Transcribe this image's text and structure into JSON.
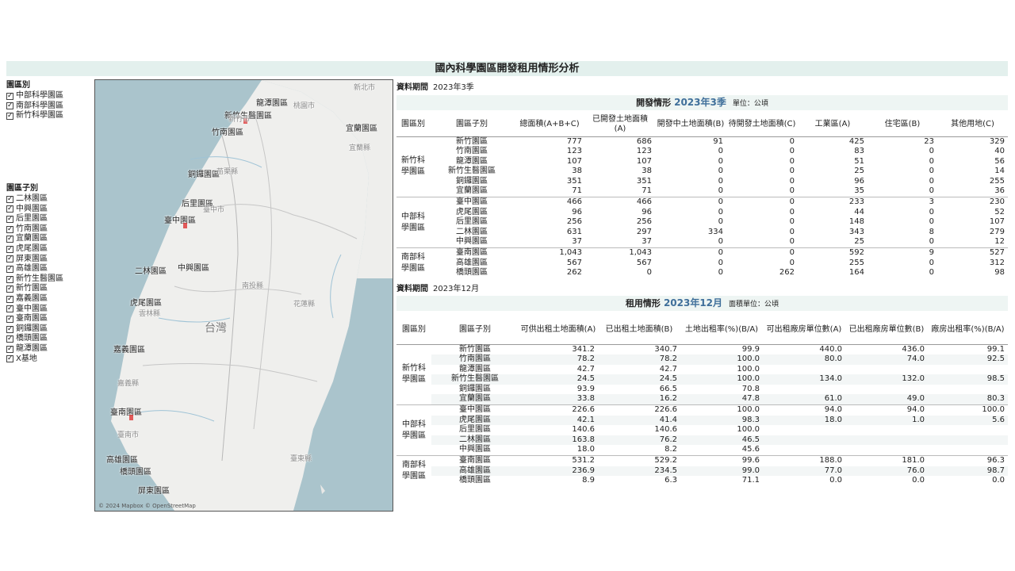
{
  "title": "國內科學園區開發租用情形分析",
  "filters": {
    "park_heading": "園區別",
    "parks": [
      "中部科學園區",
      "南部科學園區",
      "新竹科學園區"
    ],
    "sub_heading": "園區子別",
    "subs": [
      "二林園區",
      "中興園區",
      "后里園區",
      "竹南園區",
      "宜蘭園區",
      "虎尾園區",
      "屏東園區",
      "高雄園區",
      "新竹生醫園區",
      "新竹園區",
      "嘉義園區",
      "臺中園區",
      "臺南園區",
      "銅鑼園區",
      "橋頭園區",
      "龍潭園區",
      "X基地"
    ]
  },
  "map": {
    "attribution": "© 2024 Mapbox © OpenStreetMap",
    "labels": [
      "龍潭園區",
      "新竹生醫園區",
      "竹南園區",
      "宜蘭園區",
      "銅鑼園區",
      "后里園區",
      "臺中園區",
      "二林園區",
      "中興園區",
      "虎尾園區",
      "嘉義園區",
      "臺南園區",
      "高雄園區",
      "橋頭園區",
      "屏東園區"
    ],
    "minor_labels": [
      "新北市",
      "桃園市",
      "新竹市",
      "宜蘭縣",
      "苗栗縣",
      "臺中市",
      "南投縣",
      "花蓮縣",
      "雲林縣",
      "嘉義縣",
      "臺南市",
      "臺東縣"
    ],
    "big_label": "台灣"
  },
  "dev": {
    "period_label": "資料期間",
    "period_value": "2023年3季",
    "section": "開發情形",
    "highlight": "2023年3季",
    "unit": "單位：公頃",
    "headers": [
      "園區別",
      "園區子別",
      "總面積(A+B+C)",
      "已開發土地面積(A)",
      "開發中土地面積(B)",
      "待開發土地面積(C)",
      "工業區(A)",
      "住宅區(B)",
      "其他用地(C)"
    ],
    "groups": [
      {
        "name": "新竹科學園區",
        "rows": [
          [
            "新竹園區",
            "777",
            "686",
            "91",
            "0",
            "425",
            "23",
            "329"
          ],
          [
            "竹南園區",
            "123",
            "123",
            "0",
            "0",
            "83",
            "0",
            "40"
          ],
          [
            "龍潭園區",
            "107",
            "107",
            "0",
            "0",
            "51",
            "0",
            "56"
          ],
          [
            "新竹生醫園區",
            "38",
            "38",
            "0",
            "0",
            "25",
            "0",
            "14"
          ],
          [
            "銅鑼園區",
            "351",
            "351",
            "0",
            "0",
            "96",
            "0",
            "255"
          ],
          [
            "宜蘭園區",
            "71",
            "71",
            "0",
            "0",
            "35",
            "0",
            "36"
          ]
        ]
      },
      {
        "name": "中部科學園區",
        "rows": [
          [
            "臺中園區",
            "466",
            "466",
            "0",
            "0",
            "233",
            "3",
            "230"
          ],
          [
            "虎尾園區",
            "96",
            "96",
            "0",
            "0",
            "44",
            "0",
            "52"
          ],
          [
            "后里園區",
            "256",
            "256",
            "0",
            "0",
            "148",
            "0",
            "107"
          ],
          [
            "二林園區",
            "631",
            "297",
            "334",
            "0",
            "343",
            "8",
            "279"
          ],
          [
            "中興園區",
            "37",
            "37",
            "0",
            "0",
            "25",
            "0",
            "12"
          ]
        ]
      },
      {
        "name": "南部科學園區",
        "rows": [
          [
            "臺南園區",
            "1,043",
            "1,043",
            "0",
            "0",
            "592",
            "9",
            "527"
          ],
          [
            "高雄園區",
            "567",
            "567",
            "0",
            "0",
            "255",
            "0",
            "312"
          ],
          [
            "橋頭園區",
            "262",
            "0",
            "0",
            "262",
            "164",
            "0",
            "98"
          ]
        ]
      }
    ]
  },
  "rent": {
    "period_label": "資料期間",
    "period_value": "2023年12月",
    "section": "租用情形",
    "highlight": "2023年12月",
    "unit": "面積單位：公頃",
    "headers": [
      "園區別",
      "園區子別",
      "可供出租土地面積(A)",
      "已出租土地面積(B)",
      "土地出租率(%)(B/A)",
      "可出租廠房單位數(A)",
      "已出租廠房單位數(B)",
      "廠房出租率(%)(B/A)"
    ],
    "groups": [
      {
        "name": "新竹科學園區",
        "rows": [
          [
            "新竹園區",
            "341.2",
            "340.7",
            "99.9",
            "440.0",
            "436.0",
            "99.1"
          ],
          [
            "竹南園區",
            "78.2",
            "78.2",
            "100.0",
            "80.0",
            "74.0",
            "92.5"
          ],
          [
            "龍潭園區",
            "42.7",
            "42.7",
            "100.0",
            "",
            "",
            ""
          ],
          [
            "新竹生醫園區",
            "24.5",
            "24.5",
            "100.0",
            "134.0",
            "132.0",
            "98.5"
          ],
          [
            "銅鑼園區",
            "93.9",
            "66.5",
            "70.8",
            "",
            "",
            ""
          ],
          [
            "宜蘭園區",
            "33.8",
            "16.2",
            "47.8",
            "61.0",
            "49.0",
            "80.3"
          ]
        ]
      },
      {
        "name": "中部科學園區",
        "rows": [
          [
            "臺中園區",
            "226.6",
            "226.6",
            "100.0",
            "94.0",
            "94.0",
            "100.0"
          ],
          [
            "虎尾園區",
            "42.1",
            "41.4",
            "98.3",
            "18.0",
            "1.0",
            "5.6"
          ],
          [
            "后里園區",
            "140.6",
            "140.6",
            "100.0",
            "",
            "",
            ""
          ],
          [
            "二林園區",
            "163.8",
            "76.2",
            "46.5",
            "",
            "",
            ""
          ],
          [
            "中興園區",
            "18.0",
            "8.2",
            "45.6",
            "",
            "",
            ""
          ]
        ]
      },
      {
        "name": "南部科學園區",
        "rows": [
          [
            "臺南園區",
            "531.2",
            "529.2",
            "99.6",
            "188.0",
            "181.0",
            "96.3"
          ],
          [
            "高雄園區",
            "236.9",
            "234.5",
            "99.0",
            "77.0",
            "76.0",
            "98.7"
          ],
          [
            "橋頭園區",
            "8.9",
            "6.3",
            "71.1",
            "0.0",
            "0.0",
            "0.0"
          ]
        ]
      }
    ]
  }
}
